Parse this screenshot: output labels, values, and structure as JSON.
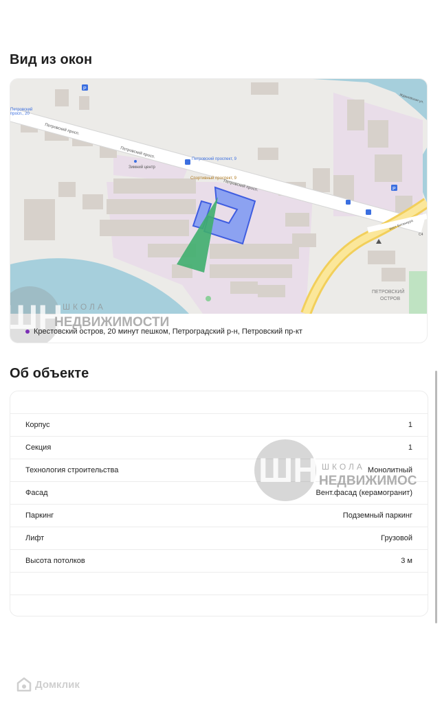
{
  "views": {
    "title": "Вид из окон",
    "location": "Крестовский остров, 20 минут пешком, Петроградский р-н, Петровский пр-кт",
    "map_labels": {
      "street1": "Петровский просп.",
      "street2": "Петровский просп.",
      "street3": "Петровский просп.",
      "busstop": "Петровский проспект, 9",
      "district": "ПЕТРОВСКИЙ",
      "district2": "ОСТРОВ",
      "bridge": "мост Бетанкура",
      "quay": "Ждановская ул.",
      "stop_top_l1": "Петровский",
      "stop_top_l2": "просп., 20",
      "route_shield": "С4",
      "place1": "Зимний центр",
      "place2": "Спортивный проспект, 9"
    },
    "colors": {
      "map_bg": "#ecebe8",
      "water": "#a6cfdc",
      "territory": "#e8dce8",
      "building": "#d9d4cf",
      "highlight": "#6e8ff0",
      "view_cone": "#3fae6e",
      "road": "#f7d873"
    }
  },
  "watermark": {
    "line1": "ШКОЛА",
    "line2": "НЕДВИЖИМОСТИ",
    "line2_cut": "НЕДВИЖИМОС",
    "logo": "ШН"
  },
  "about": {
    "title": "Об объекте",
    "rows": [
      {
        "label": "Корпус",
        "value": "1"
      },
      {
        "label": "Секция",
        "value": "1"
      },
      {
        "label": "Технология строительства",
        "value": "Монолитный"
      },
      {
        "label": "Фасад",
        "value": "Вент.фасад (керамогранит)"
      },
      {
        "label": "Паркинг",
        "value": "Подземный паркинг"
      },
      {
        "label": "Лифт",
        "value": "Грузовой"
      },
      {
        "label": "Высота потолков",
        "value": "3 м"
      }
    ]
  },
  "footer": {
    "brand": "Домклик"
  }
}
